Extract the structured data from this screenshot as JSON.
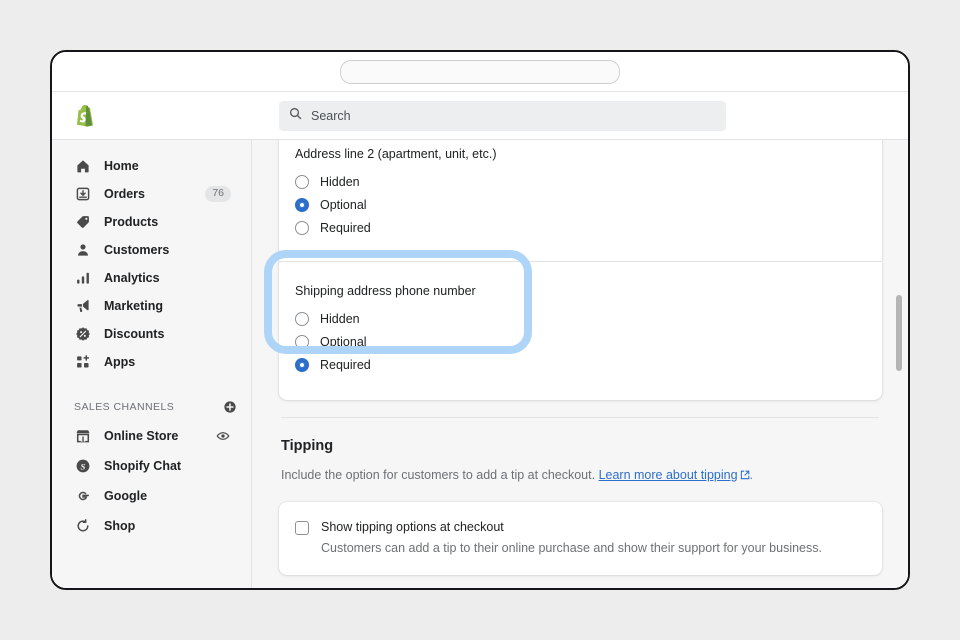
{
  "browser": {
    "address_bar_value": "",
    "address_bar_placeholder": ""
  },
  "topbar": {
    "logo": "shopify-logo",
    "search": {
      "icon": "search-icon",
      "placeholder": "Search",
      "value": "Search"
    }
  },
  "sidebar": {
    "items": [
      {
        "label": "Home",
        "icon": "home-icon",
        "badge": ""
      },
      {
        "label": "Orders",
        "icon": "orders-icon",
        "badge": "76"
      },
      {
        "label": "Products",
        "icon": "products-tag-icon",
        "badge": ""
      },
      {
        "label": "Customers",
        "icon": "customers-person-icon",
        "badge": ""
      },
      {
        "label": "Analytics",
        "icon": "analytics-bar-chart-icon",
        "badge": ""
      },
      {
        "label": "Marketing",
        "icon": "marketing-megaphone-icon",
        "badge": ""
      },
      {
        "label": "Discounts",
        "icon": "discounts-badge-icon",
        "badge": ""
      },
      {
        "label": "Apps",
        "icon": "apps-grid-plus-icon",
        "badge": ""
      }
    ],
    "sales_channels": {
      "title": "SALES CHANNELS",
      "add_icon": "circle-plus-icon",
      "items": [
        {
          "label": "Online Store",
          "icon": "storefront-icon",
          "trail_icon": "eye-icon"
        },
        {
          "label": "Shopify Chat",
          "icon": "shopify-chat-icon",
          "trail_icon": ""
        },
        {
          "label": "Google",
          "icon": "google-g-icon",
          "trail_icon": ""
        },
        {
          "label": "Shop",
          "icon": "shop-icon",
          "trail_icon": ""
        }
      ]
    }
  },
  "main": {
    "address_line_2": {
      "label": "Address line 2 (apartment, unit, etc.)",
      "options": [
        "Hidden",
        "Optional",
        "Required"
      ],
      "selected": "Optional"
    },
    "shipping_phone": {
      "label": "Shipping address phone number",
      "options": [
        "Hidden",
        "Optional",
        "Required"
      ],
      "selected": "Required",
      "highlight_color": "#aed5f7"
    },
    "tipping": {
      "title": "Tipping",
      "description_before": "Include the option for customers to add a tip at checkout.",
      "link_label": "Learn more about tipping",
      "link_icon": "external-link-icon",
      "description_after": ".",
      "checkbox": {
        "label": "Show tipping options at checkout",
        "checked": false,
        "help": "Customers can add a tip to their online purchase and show their support for your business."
      }
    }
  },
  "colors": {
    "accent_blue": "#2c6ecb",
    "highlight_blue": "#aed5f7",
    "page_bg": "#f6f6f7",
    "desktop_bg": "#ededed"
  }
}
